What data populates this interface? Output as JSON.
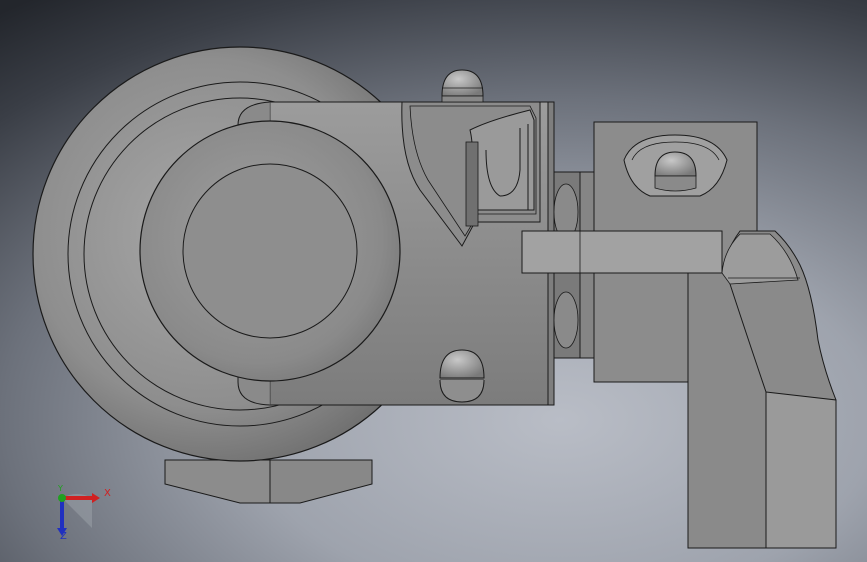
{
  "viewport": {
    "background_top": "#23262c",
    "background_bottom": "#b9bdc6"
  },
  "model": {
    "body_color": "#8a8a8a",
    "edge_color": "#1a1a1a",
    "highlight_color": "#b5b5b5"
  },
  "triad": {
    "x_label": "X",
    "y_label": "Y",
    "z_label": "Z",
    "x_color": "#d02020",
    "y_color": "#20a020",
    "z_color": "#2030c0"
  }
}
